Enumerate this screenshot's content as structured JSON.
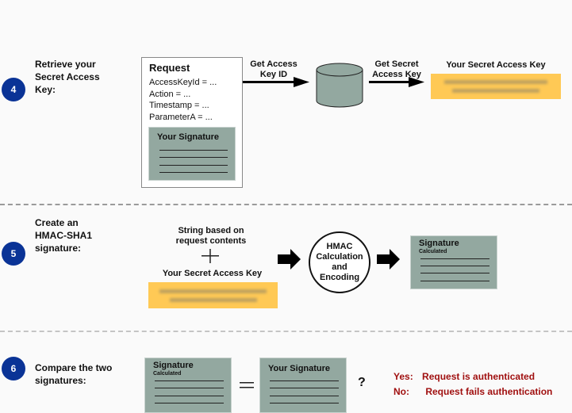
{
  "steps": [
    {
      "number": "4",
      "label_lines": [
        "Retrieve your",
        "Secret Access",
        "Key:"
      ],
      "request": {
        "title": "Request",
        "fields": [
          "AccessKeyId = ...",
          "Action = ...",
          "Timestamp = ...",
          "ParameterA = ..."
        ],
        "signature_title": "Your Signature"
      },
      "arrow1_label": [
        "Get Access",
        "Key ID"
      ],
      "arrow2_label": [
        "Get Secret",
        "Access Key"
      ],
      "database_icon": "database-cylinder-icon",
      "secret_key_title": "Your Secret Access Key"
    },
    {
      "number": "5",
      "label_lines": [
        "Create an",
        "HMAC-SHA1",
        "signature:"
      ],
      "string_label": [
        "String based on",
        "request contents"
      ],
      "plus": "+",
      "secret_key_title": "Your Secret Access Key",
      "hmac_lines": [
        "HMAC",
        "Calculation",
        "and",
        "Encoding"
      ],
      "signature_title": "Signature",
      "signature_subtitle": "Calculated"
    },
    {
      "number": "6",
      "label_lines": [
        "Compare the two",
        "signatures:"
      ],
      "left_sig_title": "Signature",
      "left_sig_subtitle": "Calculated",
      "equals": "=",
      "right_sig_title": "Your Signature",
      "question": "?",
      "results": [
        {
          "key": "Yes:",
          "text": "Request is authenticated"
        },
        {
          "key": "No:",
          "text": "Request fails authentication"
        }
      ]
    }
  ],
  "colors": {
    "badge": "#0a3396",
    "signature_card": "#93a8a0",
    "secret_key_box": "#ffc955",
    "result_text": "#a01010"
  }
}
